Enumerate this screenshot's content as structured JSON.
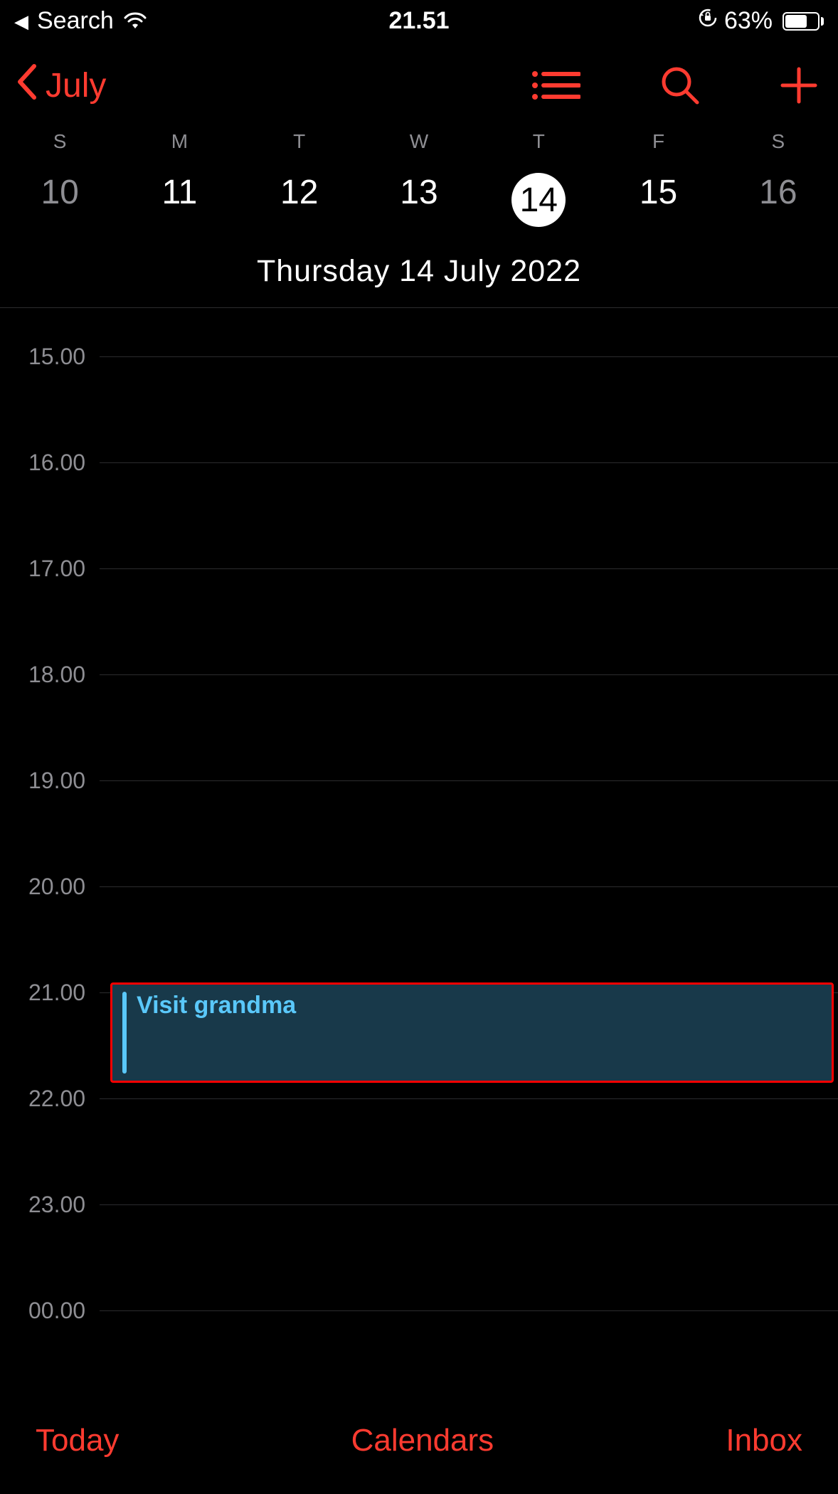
{
  "status_bar": {
    "back_app": "Search",
    "time": "21.51",
    "battery_percent": "63%"
  },
  "nav": {
    "month": "July"
  },
  "week": {
    "day_letters": [
      "S",
      "M",
      "T",
      "W",
      "T",
      "F",
      "S"
    ],
    "day_numbers": [
      "10",
      "11",
      "12",
      "13",
      "14",
      "15",
      "16"
    ],
    "selected_index": 4,
    "weekend_indices": [
      0,
      6
    ]
  },
  "full_date": "Thursday  14 July 2022",
  "timeline": {
    "hours": [
      "15.00",
      "16.00",
      "17.00",
      "18.00",
      "19.00",
      "20.00",
      "21.00",
      "22.00",
      "23.00",
      "00.00"
    ],
    "hour_spacing_px": 149
  },
  "event": {
    "title": "Visit grandma",
    "start_hour_index": 6,
    "end_hour_index": 7,
    "highlight": true
  },
  "toolbar": {
    "today": "Today",
    "calendars": "Calendars",
    "inbox": "Inbox"
  },
  "colors": {
    "accent": "#ff3b30",
    "event_bg": "#18394a",
    "event_text": "#5ac8fa",
    "highlight_border": "#ff0000"
  }
}
